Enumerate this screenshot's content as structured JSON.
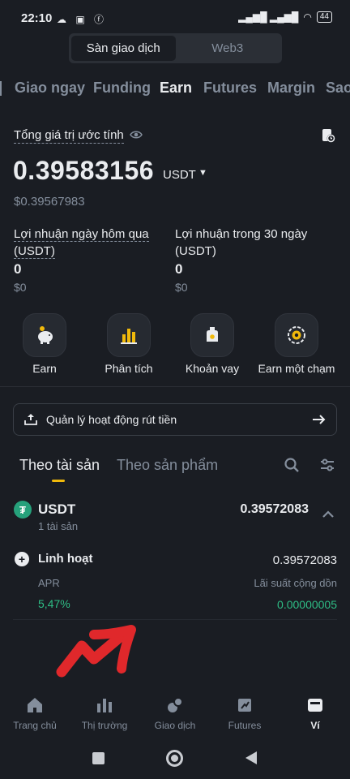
{
  "status_bar": {
    "time": "22:10",
    "battery": "44"
  },
  "segment": {
    "exchange": "Sàn giao dịch",
    "web3": "Web3"
  },
  "tabs": [
    "Giao ngay",
    "Funding",
    "Earn",
    "Futures",
    "Margin",
    "Sao"
  ],
  "active_tab": "Earn",
  "balance": {
    "label": "Tổng giá trị ước tính",
    "amount": "0.39583156",
    "unit": "USDT",
    "usd": "$0.39567983"
  },
  "pnl": {
    "yesterday_label": "Lợi nhuận ngày hôm qua (USDT)",
    "yesterday_label_l1": "Lợi nhuận ngày hôm qua",
    "yesterday_label_l2": "(USDT)",
    "yesterday_value": "0",
    "yesterday_usd": "$0",
    "month_label_l1": "Lợi nhuận trong 30 ngày",
    "month_label_l2": "(USDT)",
    "month_value": "0",
    "month_usd": "$0"
  },
  "quick_actions": [
    {
      "label": "Earn",
      "icon": "piggy-bank-icon"
    },
    {
      "label": "Phân tích",
      "icon": "bar-chart-icon"
    },
    {
      "label": "Khoản vay",
      "icon": "loan-bag-icon"
    },
    {
      "label": "Earn một chạm",
      "icon": "one-tap-icon"
    }
  ],
  "banner": {
    "label": "Quản lý hoạt động rút tiền"
  },
  "sub_tabs": {
    "by_asset": "Theo tài sản",
    "by_product": "Theo sản phẩm"
  },
  "asset": {
    "name": "USDT",
    "count": "1 tài sản",
    "amount": "0.39572083",
    "product": {
      "name": "Linh hoạt",
      "amount": "0.39572083",
      "apr_label": "APR",
      "apr_value": "5,47%",
      "cum_label": "Lãi suất cộng dồn",
      "cum_value": "0.00000005"
    }
  },
  "bottom_nav": [
    {
      "label": "Trang chủ",
      "icon": "home-icon"
    },
    {
      "label": "Thị trường",
      "icon": "market-icon"
    },
    {
      "label": "Giao dịch",
      "icon": "trade-icon"
    },
    {
      "label": "Futures",
      "icon": "futures-icon"
    },
    {
      "label": "Ví",
      "icon": "wallet-icon"
    }
  ],
  "colors": {
    "background": "#1a1d23",
    "accent": "#f0b90b",
    "positive": "#2ebd85",
    "muted": "#848e9c",
    "annotation_arrow": "#e0282b"
  }
}
